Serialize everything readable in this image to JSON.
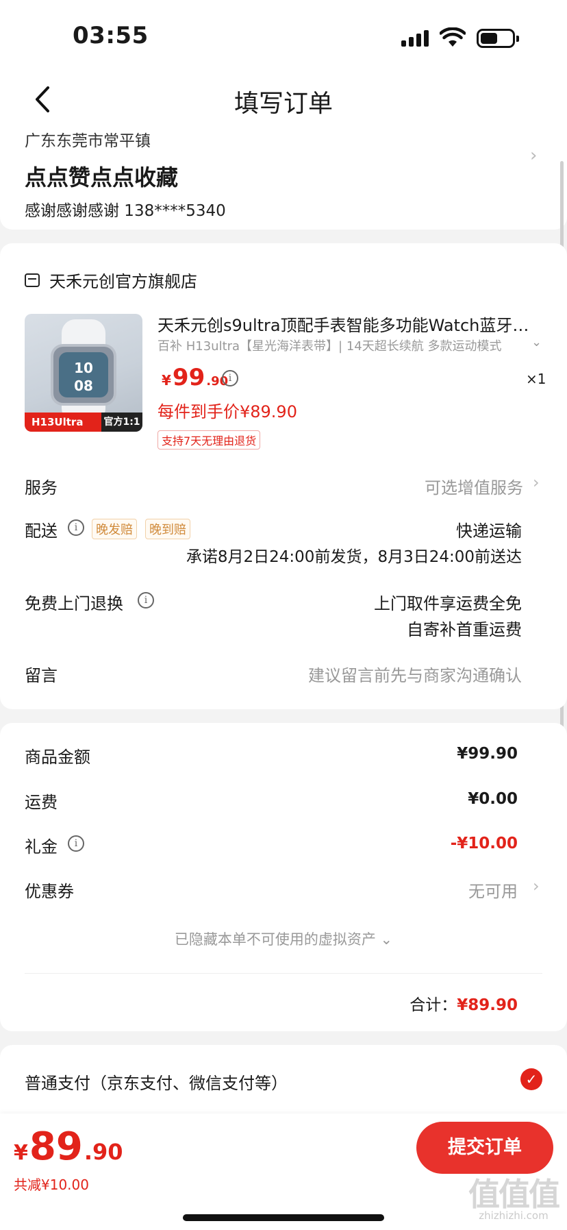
{
  "status": {
    "time": "03:55"
  },
  "nav": {
    "title": "填写订单"
  },
  "address": {
    "region": "广东东莞市常平镇",
    "name": "点点赞点点收藏",
    "contact": "感谢感谢感谢  138****5340"
  },
  "store": {
    "name": "天禾元创官方旗舰店"
  },
  "product": {
    "title": "天禾元创s9ultra顶配手表智能多功能Watch蓝牙通话",
    "spec": "百补 H13ultra【星光海洋表带】| 14天超长续航 多款运动模式",
    "thumb_tag_left": "H13Ultra",
    "thumb_tag_right": "官方1:1",
    "watch_time_h": "10",
    "watch_time_m": "08",
    "price_yen": "¥",
    "price_int": "99",
    "price_dec": ".90",
    "qty": "×1",
    "each_price": "每件到手价¥89.90",
    "return_tag": "支持7天无理由退货"
  },
  "rows": {
    "service_label": "服务",
    "service_value": "可选增值服务",
    "delivery_label": "配送",
    "delivery_tag1": "晚发赔",
    "delivery_tag2": "晚到赔",
    "delivery_value": "快递运输",
    "delivery_promise": "承诺8月2日24:00前发货，8月3日24:00前送达",
    "return_label": "免费上门退换",
    "return_value1": "上门取件享运费全免",
    "return_value2": "自寄补首重运费",
    "message_label": "留言",
    "message_placeholder": "建议留言前先与商家沟通确认"
  },
  "summary": {
    "goods_label": "商品金额",
    "goods_value": "¥99.90",
    "shipping_label": "运费",
    "shipping_value": "¥0.00",
    "gift_label": "礼金",
    "gift_value": "-¥10.00",
    "coupon_label": "优惠券",
    "coupon_value": "无可用",
    "hidden_assets": "已隐藏本单不可使用的虚拟资产",
    "total_label": "合计：",
    "total_value": "¥89.90"
  },
  "payment": {
    "label": "普通支付（京东支付、微信支付等）"
  },
  "bottom": {
    "yen": "¥",
    "int": "89",
    "dec": ".90",
    "discount": "共减¥10.00",
    "submit": "提交订单"
  },
  "watermark": {
    "main": "值值值",
    "sub": "zhizhizhi.com"
  },
  "colors": {
    "accent": "#e2231a",
    "tag_orange": "#d08a3a"
  }
}
